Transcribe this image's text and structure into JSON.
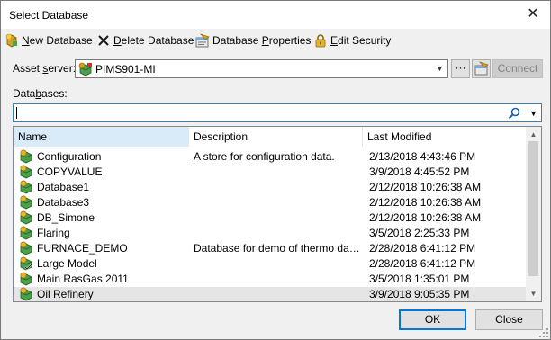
{
  "window": {
    "title": "Select Database",
    "close_glyph": "✕"
  },
  "toolbar": {
    "new_database": {
      "mnemonic": "N",
      "rest": "ew Database",
      "icon": "new-database-icon"
    },
    "delete_database": {
      "mnemonic": "D",
      "rest": "elete Database",
      "icon": "delete-x-icon"
    },
    "database_properties": {
      "before": "Database ",
      "mnemonic": "P",
      "rest": "roperties",
      "icon": "properties-icon"
    },
    "edit_security": {
      "mnemonic": "E",
      "rest": "dit Security",
      "icon": "lock-icon"
    }
  },
  "asset_server": {
    "label_before": "Asset ",
    "label_mnemonic": "s",
    "label_rest": "erver:",
    "value": "PIMS901-MI",
    "more_glyph": "···",
    "connect_label": "Connect"
  },
  "databases": {
    "label_before": "Data",
    "label_mnemonic": "b",
    "label_rest": "ases:",
    "search_value": ""
  },
  "columns": {
    "name": "Name",
    "description": "Description",
    "last_modified": "Last Modified"
  },
  "rows": [
    {
      "name": "Configuration",
      "description": "A store for configuration data.",
      "modified": "2/13/2018 4:43:46 PM",
      "icon": "database-icon"
    },
    {
      "name": "COPYVALUE",
      "description": "",
      "modified": "3/9/2018 4:45:52 PM",
      "icon": "database-icon"
    },
    {
      "name": "Database1",
      "description": "",
      "modified": "2/12/2018 10:26:38 AM",
      "icon": "database-icon"
    },
    {
      "name": "Database3",
      "description": "",
      "modified": "2/12/2018 10:26:38 AM",
      "icon": "database-icon"
    },
    {
      "name": "DB_Simone",
      "description": "",
      "modified": "2/12/2018 10:26:38 AM",
      "icon": "database-icon"
    },
    {
      "name": "Flaring",
      "description": "",
      "modified": "3/5/2018 2:25:33 PM",
      "icon": "database-icon"
    },
    {
      "name": "FURNACE_DEMO",
      "description": "Database for demo of thermo data ...",
      "modified": "2/28/2018 6:41:12 PM",
      "icon": "database-icon"
    },
    {
      "name": "Large Model",
      "description": "",
      "modified": "2/28/2018 6:41:12 PM",
      "icon": "database-check-icon"
    },
    {
      "name": "Main RasGas 2011",
      "description": "",
      "modified": "3/5/2018 1:35:01 PM",
      "icon": "database-icon"
    },
    {
      "name": "Oil Refinery",
      "description": "",
      "modified": "3/9/2018 9:05:35 PM",
      "icon": "database-icon",
      "selected": true
    }
  ],
  "buttons": {
    "ok": "OK",
    "close": "Close"
  },
  "colors": {
    "selection": "#e5e5e5",
    "sorted_header": "#d9ebf9",
    "focus_border": "#0078d7"
  }
}
